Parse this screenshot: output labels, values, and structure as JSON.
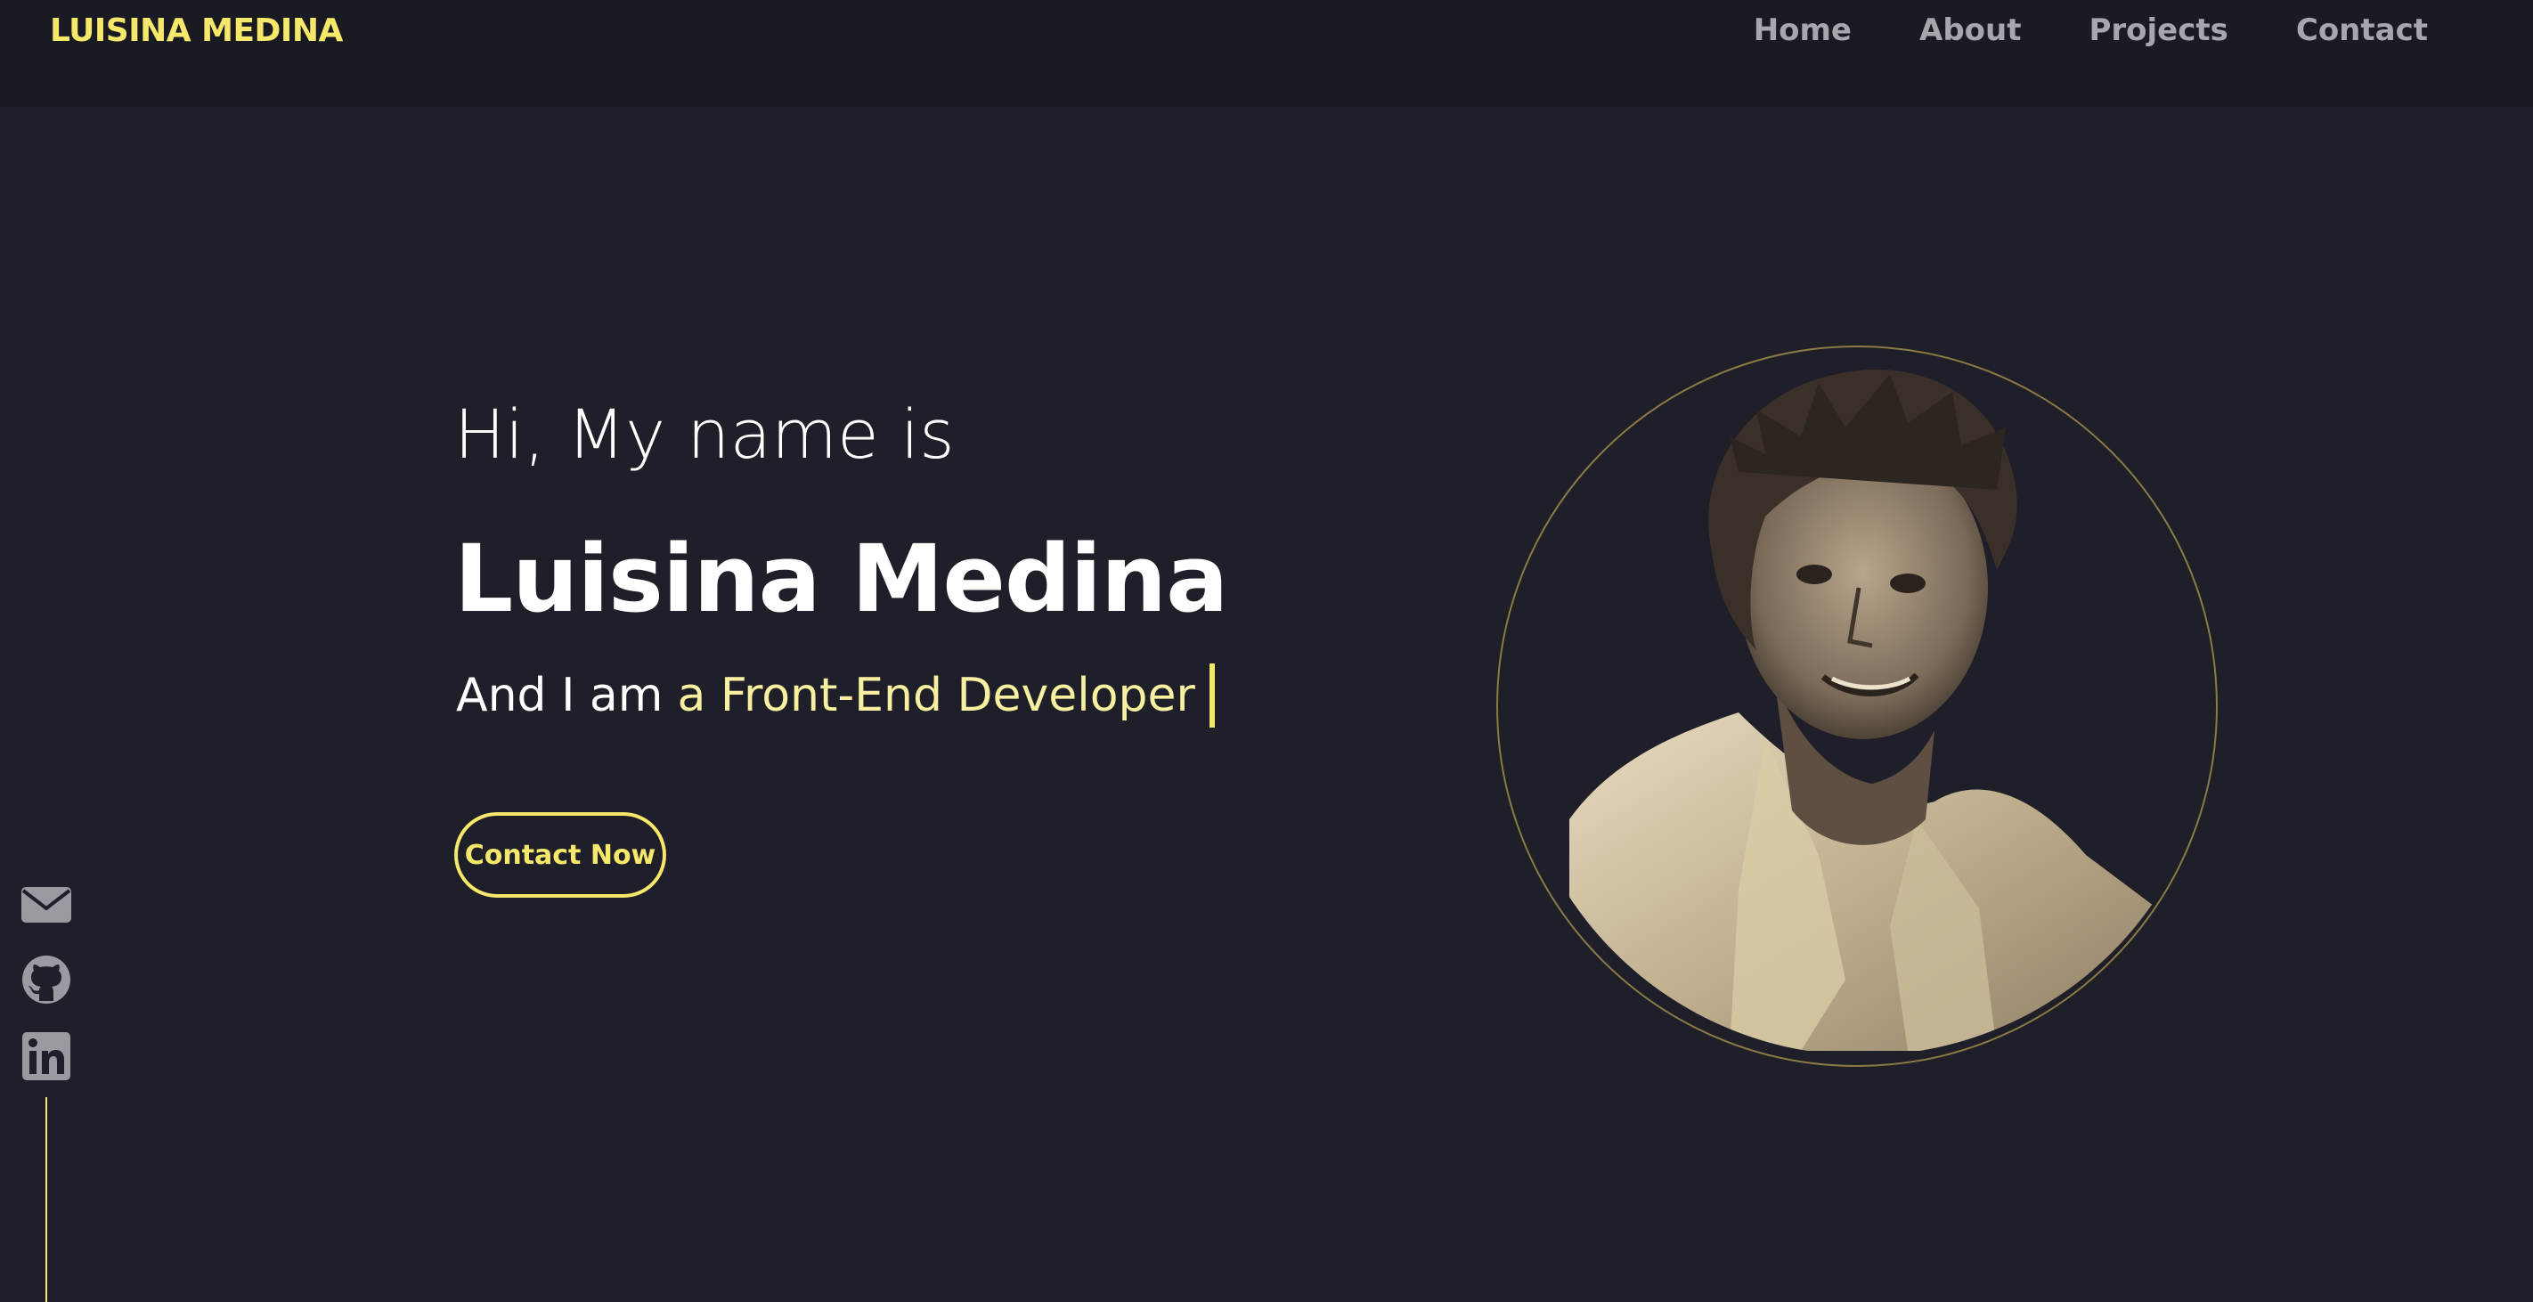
{
  "header": {
    "logo": "LUISINA MEDINA",
    "nav": [
      {
        "label": "Home"
      },
      {
        "label": "About"
      },
      {
        "label": "Projects"
      },
      {
        "label": "Contact"
      }
    ]
  },
  "hero": {
    "greeting": "Hi, My name is",
    "name": "Luisina Medina",
    "subtitle_prefix": "And I am",
    "subtitle_role": "a Front-End Developer",
    "cta_label": "Contact Now"
  },
  "social": {
    "icons": [
      "envelope-icon",
      "github-icon",
      "linkedin-icon"
    ]
  },
  "colors": {
    "background": "#1f1f29",
    "navbar": "#1a1a23",
    "accent": "#f6e86b",
    "accent_soft": "#f8f0a0",
    "nav_text": "#a7a6ad",
    "icon": "#9a9aa0"
  }
}
